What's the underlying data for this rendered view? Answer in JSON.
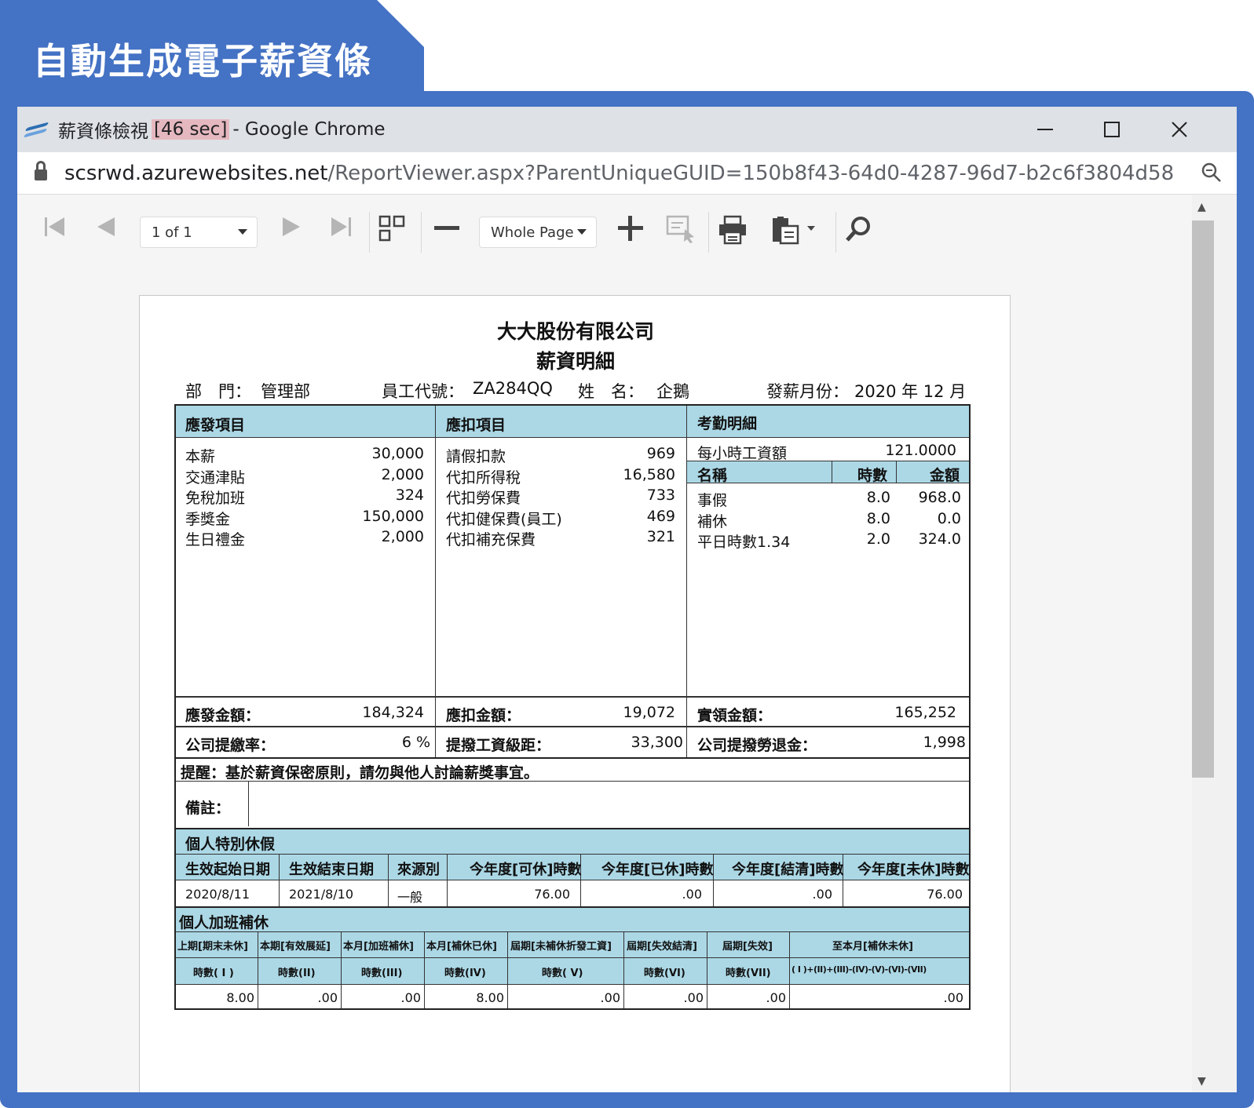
{
  "banner": {
    "title": "自動生成電子薪資條"
  },
  "window": {
    "title_prefix": "薪資條檢視",
    "title_badge": "[46 sec]",
    "title_suffix": "- Google Chrome",
    "url_host": "scsrwd.azurewebsites.net",
    "url_path": "/ReportViewer.aspx?ParentUniqueGUID=150b8f43-64d0-4287-96d7-b2c6f3804d58"
  },
  "toolbar": {
    "page_select": "1 of 1",
    "zoom_select": "Whole Page"
  },
  "report": {
    "company": "大大股份有限公司",
    "title": "薪資明細",
    "dept_label": "部　門：",
    "dept_value": "管理部",
    "emp_id_label": "員工代號：",
    "emp_id_value": "ZA284QQ",
    "name_label": "姓　名：",
    "name_value": "企鵝",
    "pay_month_label": "發薪月份：",
    "pay_month_value": "2020 年 12 月",
    "earnings_header": "應發項目",
    "deductions_header": "應扣項目",
    "attendance_header": "考勤明細",
    "earnings": [
      {
        "name": "本薪",
        "amount": "30,000"
      },
      {
        "name": "交通津貼",
        "amount": "2,000"
      },
      {
        "name": "免稅加班",
        "amount": "324"
      },
      {
        "name": "季獎金",
        "amount": "150,000"
      },
      {
        "name": "生日禮金",
        "amount": "2,000"
      }
    ],
    "deductions": [
      {
        "name": "請假扣款",
        "amount": "969"
      },
      {
        "name": "代扣所得稅",
        "amount": "16,580"
      },
      {
        "name": "代扣勞保費",
        "amount": "733"
      },
      {
        "name": "代扣健保費(員工)",
        "amount": "469"
      },
      {
        "name": "代扣補充保費",
        "amount": "321"
      }
    ],
    "hourly_label": "每小時工資額",
    "hourly_value": "121.0000",
    "att_cols": [
      "名稱",
      "時數",
      "金額"
    ],
    "attendance": [
      {
        "name": "事假",
        "hours": "8.0",
        "amount": "968.0"
      },
      {
        "name": "補休",
        "hours": "8.0",
        "amount": "0.0"
      },
      {
        "name": "平日時數1.34",
        "hours": "2.0",
        "amount": "324.0"
      }
    ],
    "gross_label": "應發金額：",
    "gross_value": "184,324",
    "deduct_total_label": "應扣金額：",
    "deduct_total_value": "19,072",
    "net_label": "實領金額：",
    "net_value": "165,252",
    "contrib_rate_label": "公司提繳率：",
    "contrib_rate_value": "6 %",
    "wage_grade_label": "提撥工資級距：",
    "wage_grade_value": "33,300",
    "pension_label": "公司提撥勞退金：",
    "pension_value": "1,998",
    "reminder": "提醒：基於薪資保密原則，請勿與他人討論薪獎事宜。",
    "remark_label": "備註：",
    "special_leave_header": "個人特別休假",
    "special_leave_cols": [
      "生效起始日期",
      "生效結束日期",
      "來源別",
      "今年度[可休]時數",
      "今年度[已休]時數",
      "今年度[結清]時數",
      "今年度[未休]時數"
    ],
    "special_leave_row": [
      "2020/8/11",
      "2021/8/10",
      "一般",
      "76.00",
      ".00",
      ".00",
      "76.00"
    ],
    "comp_header": "個人加班補休",
    "comp_cols1": [
      "上期[期末未休]",
      "本期[有效展延]",
      "本月[加班補休]",
      "本月[補休已休]",
      "屆期[未補休折發工資]",
      "屆期[失效結清]",
      "屆期[失效]",
      "至本月[補休未休]"
    ],
    "comp_cols2": [
      "時數( I )",
      "時數(II)",
      "時數(III)",
      "時數(IV)",
      "時數( V)",
      "時數(VI)",
      "時數(VII)",
      "( I )+(II)+(III)-(IV)-(V)-(VI)-(VII)"
    ],
    "comp_row": [
      "8.00",
      ".00",
      ".00",
      "8.00",
      ".00",
      ".00",
      ".00",
      ".00"
    ]
  }
}
